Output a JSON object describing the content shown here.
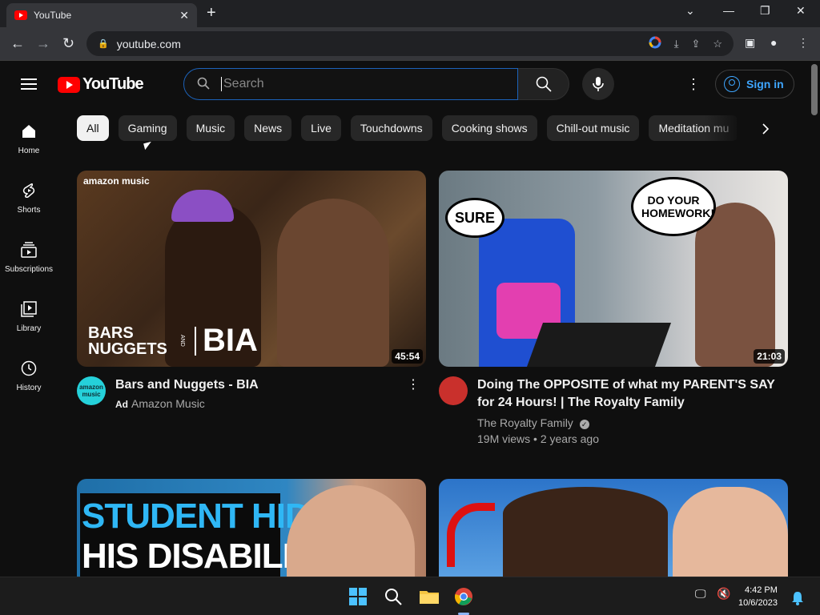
{
  "browser": {
    "tab_title": "YouTube",
    "url": "youtube.com"
  },
  "yt": {
    "logo_text": "YouTube",
    "search_placeholder": "Search",
    "signin_label": "Sign in"
  },
  "sidebar": {
    "items": [
      {
        "label": "Home"
      },
      {
        "label": "Shorts"
      },
      {
        "label": "Subscriptions"
      },
      {
        "label": "Library"
      },
      {
        "label": "History"
      }
    ]
  },
  "chips": [
    "All",
    "Gaming",
    "Music",
    "News",
    "Live",
    "Touchdowns",
    "Cooking shows",
    "Chill-out music",
    "Meditation mu"
  ],
  "videos": [
    {
      "title": "Bars and Nuggets - BIA",
      "ad_label": "Ad",
      "channel": "Amazon Music",
      "duration": "45:54",
      "thumb_brand": "amazon music",
      "thumb_text_left": "BARS NUGGETS",
      "thumb_text_and": "AND",
      "thumb_text_right": "BIA",
      "avatar_text": "amazon music"
    },
    {
      "title_line1": "Doing The OPPOSITE of what my PARENT'S SAY",
      "title_line2": "for 24 Hours! | The Royalty Family",
      "channel": "The Royalty Family",
      "views": "19M views",
      "age": "2 years ago",
      "duration": "21:03",
      "bubble_left": "SURE",
      "bubble_right": "DO YOUR HOMEWORK!"
    },
    {
      "thumb_line1": "STUDENT HIDES",
      "thumb_line2": "HIS DISABILITY"
    },
    {}
  ],
  "taskbar": {
    "time": "4:42 PM",
    "date": "10/6/2023"
  },
  "colors": {
    "bg": "#0f0f0f",
    "accent_blue": "#3ea6ff",
    "yt_red": "#ff0000"
  }
}
